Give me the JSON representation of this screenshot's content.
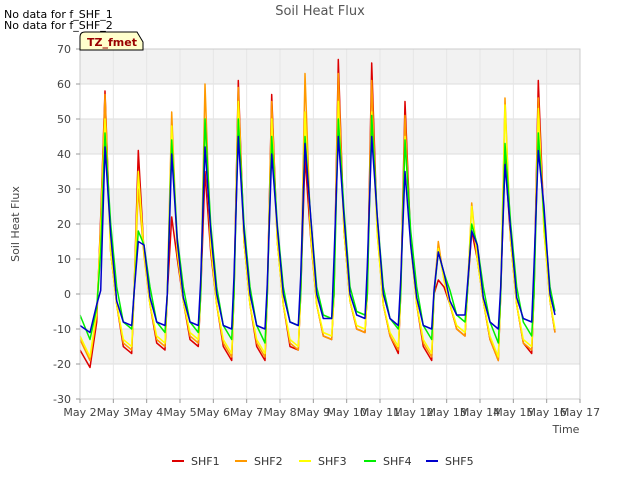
{
  "notes": [
    "No data for f_SHF_1",
    "No data for f_SHF_2"
  ],
  "badge": "TZ_fmet",
  "chart_data": {
    "type": "line",
    "title": "Soil Heat Flux",
    "xlabel": "Time",
    "ylabel": "Soil Heat Flux",
    "xlim": [
      2,
      17
    ],
    "ylim": [
      -30,
      70
    ],
    "xticks": [
      2,
      3,
      4,
      5,
      6,
      7,
      8,
      9,
      10,
      11,
      12,
      13,
      14,
      15,
      16,
      17
    ],
    "xtick_labels": [
      "May 2",
      "May 3",
      "May 4",
      "May 5",
      "May 6",
      "May 7",
      "May 8",
      "May 9",
      "May 10",
      "May 11",
      "May 12",
      "May 13",
      "May 14",
      "May 15",
      "May 16",
      "May 17"
    ],
    "yticks": [
      -30,
      -20,
      -10,
      0,
      10,
      20,
      30,
      40,
      50,
      60,
      70
    ],
    "grid": true,
    "legend_position": "bottom",
    "series": [
      {
        "name": "SHF1",
        "color": "#dd0000",
        "x": [
          2.0,
          2.3,
          2.5,
          2.62,
          2.75,
          2.92,
          3.1,
          3.3,
          3.55,
          3.62,
          3.75,
          3.92,
          4.1,
          4.3,
          4.55,
          4.62,
          4.75,
          4.92,
          5.1,
          5.3,
          5.55,
          5.62,
          5.75,
          5.92,
          6.1,
          6.3,
          6.55,
          6.62,
          6.75,
          6.92,
          7.1,
          7.3,
          7.55,
          7.62,
          7.75,
          7.92,
          8.1,
          8.3,
          8.55,
          8.62,
          8.75,
          8.92,
          9.1,
          9.3,
          9.55,
          9.62,
          9.75,
          9.92,
          10.1,
          10.3,
          10.55,
          10.62,
          10.75,
          10.92,
          11.1,
          11.3,
          11.55,
          11.62,
          11.75,
          11.92,
          12.1,
          12.3,
          12.55,
          12.62,
          12.75,
          12.92,
          13.1,
          13.3,
          13.55,
          13.62,
          13.75,
          13.92,
          14.1,
          14.3,
          14.55,
          14.62,
          14.75,
          14.92,
          15.1,
          15.3,
          15.55,
          15.62,
          15.75,
          15.92,
          16.1,
          16.25
        ],
        "y": [
          -16,
          -21,
          -8,
          22,
          58,
          12,
          -3,
          -15,
          -17,
          0,
          41,
          12,
          -3,
          -14,
          -16,
          0,
          22,
          10,
          -2,
          -13,
          -15,
          0,
          35,
          12,
          -3,
          -15,
          -19,
          0,
          61,
          15,
          -3,
          -15,
          -19,
          0,
          57,
          15,
          -3,
          -15,
          -16,
          0,
          39,
          16,
          -3,
          -12,
          -13,
          0,
          67,
          18,
          -2,
          -10,
          -11,
          0,
          66,
          18,
          -3,
          -12,
          -17,
          0,
          55,
          15,
          -3,
          -15,
          -19,
          0,
          4,
          2,
          -3,
          -10,
          -12,
          0,
          18,
          10,
          -2,
          -13,
          -19,
          0,
          40,
          15,
          -3,
          -14,
          -17,
          0,
          61,
          20,
          -2,
          -11
        ]
      },
      {
        "name": "SHF2",
        "color": "#ff9900",
        "x": [
          2.0,
          2.3,
          2.5,
          2.62,
          2.75,
          2.92,
          3.1,
          3.3,
          3.55,
          3.62,
          3.75,
          3.92,
          4.1,
          4.3,
          4.55,
          4.62,
          4.75,
          4.92,
          5.1,
          5.3,
          5.55,
          5.62,
          5.75,
          5.92,
          6.1,
          6.3,
          6.55,
          6.62,
          6.75,
          6.92,
          7.1,
          7.3,
          7.55,
          7.62,
          7.75,
          7.92,
          8.1,
          8.3,
          8.55,
          8.62,
          8.75,
          8.92,
          9.1,
          9.3,
          9.55,
          9.62,
          9.75,
          9.92,
          10.1,
          10.3,
          10.55,
          10.62,
          10.75,
          10.92,
          11.1,
          11.3,
          11.55,
          11.62,
          11.75,
          11.92,
          12.1,
          12.3,
          12.55,
          12.62,
          12.75,
          12.92,
          13.1,
          13.3,
          13.55,
          13.62,
          13.75,
          13.92,
          14.1,
          14.3,
          14.55,
          14.62,
          14.75,
          14.92,
          15.1,
          15.3,
          15.55,
          15.62,
          15.75,
          15.92,
          16.1,
          16.25
        ],
        "y": [
          -13,
          -19,
          -6,
          20,
          57,
          12,
          -3,
          -14,
          -16,
          0,
          30,
          11,
          -3,
          -13,
          -15,
          0,
          52,
          12,
          -2,
          -12,
          -14,
          0,
          60,
          14,
          -3,
          -14,
          -18,
          0,
          59,
          15,
          -3,
          -14,
          -18,
          0,
          55,
          15,
          -3,
          -14,
          -16,
          0,
          63,
          17,
          -3,
          -12,
          -13,
          0,
          63,
          18,
          -2,
          -10,
          -11,
          0,
          61,
          17,
          -3,
          -12,
          -16,
          0,
          51,
          14,
          -3,
          -14,
          -18,
          0,
          15,
          4,
          -3,
          -10,
          -12,
          0,
          26,
          10,
          -2,
          -13,
          -19,
          0,
          56,
          15,
          -3,
          -14,
          -16,
          0,
          56,
          18,
          -2,
          -11
        ]
      },
      {
        "name": "SHF3",
        "color": "#ffff00",
        "x": [
          2.0,
          2.3,
          2.5,
          2.62,
          2.75,
          2.92,
          3.1,
          3.3,
          3.55,
          3.62,
          3.75,
          3.92,
          4.1,
          4.3,
          4.55,
          4.62,
          4.75,
          4.92,
          5.1,
          5.3,
          5.55,
          5.62,
          5.75,
          5.92,
          6.1,
          6.3,
          6.55,
          6.62,
          6.75,
          6.92,
          7.1,
          7.3,
          7.55,
          7.62,
          7.75,
          7.92,
          8.1,
          8.3,
          8.55,
          8.62,
          8.75,
          8.92,
          9.1,
          9.3,
          9.55,
          9.62,
          9.75,
          9.92,
          10.1,
          10.3,
          10.55,
          10.62,
          10.75,
          10.92,
          11.1,
          11.3,
          11.55,
          11.62,
          11.75,
          11.92,
          12.1,
          12.3,
          12.55,
          12.62,
          12.75,
          12.92,
          13.1,
          13.3,
          13.55,
          13.62,
          13.75,
          13.92,
          14.1,
          14.3,
          14.55,
          14.62,
          14.75,
          14.92,
          15.1,
          15.3,
          15.55,
          15.62,
          15.75,
          15.92,
          16.1,
          16.25
        ],
        "y": [
          -12,
          -18,
          -5,
          18,
          50,
          12,
          -3,
          -13,
          -15,
          0,
          35,
          12,
          -3,
          -12,
          -14,
          0,
          48,
          12,
          -2,
          -11,
          -13,
          0,
          50,
          14,
          -3,
          -13,
          -17,
          0,
          55,
          15,
          -3,
          -13,
          -17,
          0,
          50,
          15,
          -3,
          -13,
          -15,
          0,
          52,
          17,
          -3,
          -11,
          -12,
          0,
          55,
          18,
          -2,
          -9,
          -10,
          0,
          52,
          17,
          -3,
          -11,
          -15,
          0,
          45,
          14,
          -3,
          -13,
          -17,
          0,
          13,
          4,
          -3,
          -9,
          -11,
          0,
          25,
          10,
          -2,
          -12,
          -18,
          0,
          54,
          15,
          -3,
          -13,
          -15,
          0,
          53,
          18,
          -2,
          -10
        ]
      },
      {
        "name": "SHF4",
        "color": "#00ee00",
        "x": [
          2.0,
          2.3,
          2.5,
          2.62,
          2.75,
          2.92,
          3.1,
          3.3,
          3.55,
          3.62,
          3.75,
          3.92,
          4.1,
          4.3,
          4.55,
          4.62,
          4.75,
          4.92,
          5.1,
          5.3,
          5.55,
          5.62,
          5.75,
          5.92,
          6.1,
          6.3,
          6.55,
          6.62,
          6.75,
          6.92,
          7.1,
          7.3,
          7.55,
          7.62,
          7.75,
          7.92,
          8.1,
          8.3,
          8.55,
          8.62,
          8.75,
          8.92,
          9.1,
          9.3,
          9.55,
          9.62,
          9.75,
          9.92,
          10.1,
          10.3,
          10.55,
          10.62,
          10.75,
          10.92,
          11.1,
          11.3,
          11.55,
          11.62,
          11.75,
          11.92,
          12.1,
          12.3,
          12.55,
          12.62,
          12.75,
          12.92,
          13.1,
          13.3,
          13.55,
          13.62,
          13.75,
          13.92,
          14.1,
          14.3,
          14.55,
          14.62,
          14.75,
          14.92,
          15.1,
          15.3,
          15.55,
          15.62,
          15.75,
          15.92,
          16.1,
          16.25
        ],
        "y": [
          -6,
          -13,
          -4,
          12,
          46,
          20,
          2,
          -8,
          -10,
          0,
          18,
          14,
          2,
          -8,
          -11,
          0,
          44,
          16,
          2,
          -8,
          -11,
          0,
          50,
          20,
          2,
          -9,
          -13,
          0,
          50,
          20,
          2,
          -9,
          -14,
          0,
          45,
          20,
          2,
          -8,
          -9,
          0,
          45,
          22,
          2,
          -6,
          -7,
          0,
          50,
          24,
          2,
          -5,
          -6,
          0,
          51,
          22,
          2,
          -7,
          -10,
          0,
          44,
          18,
          2,
          -9,
          -13,
          0,
          12,
          6,
          1,
          -6,
          -8,
          0,
          20,
          14,
          2,
          -8,
          -14,
          0,
          43,
          20,
          2,
          -8,
          -12,
          0,
          46,
          22,
          2,
          -5
        ]
      },
      {
        "name": "SHF5",
        "color": "#0000cc",
        "x": [
          2.0,
          2.3,
          2.5,
          2.62,
          2.75,
          2.92,
          3.1,
          3.3,
          3.55,
          3.62,
          3.75,
          3.92,
          4.1,
          4.3,
          4.55,
          4.62,
          4.75,
          4.92,
          5.1,
          5.3,
          5.55,
          5.62,
          5.75,
          5.92,
          6.1,
          6.3,
          6.55,
          6.62,
          6.75,
          6.92,
          7.1,
          7.3,
          7.55,
          7.62,
          7.75,
          7.92,
          8.1,
          8.3,
          8.55,
          8.62,
          8.75,
          8.92,
          9.1,
          9.3,
          9.55,
          9.62,
          9.75,
          9.92,
          10.1,
          10.3,
          10.55,
          10.62,
          10.75,
          10.92,
          11.1,
          11.3,
          11.55,
          11.62,
          11.75,
          11.92,
          12.1,
          12.3,
          12.55,
          12.62,
          12.75,
          12.92,
          13.1,
          13.3,
          13.55,
          13.62,
          13.75,
          13.92,
          14.1,
          14.3,
          14.55,
          14.62,
          14.75,
          14.92,
          15.1,
          15.3,
          15.55,
          15.62,
          15.75,
          15.92,
          16.1,
          16.25
        ],
        "y": [
          -9,
          -11,
          -3,
          1,
          42,
          17,
          -2,
          -8,
          -9,
          0,
          15,
          14,
          -1,
          -8,
          -9,
          0,
          40,
          15,
          -1,
          -8,
          -9,
          4,
          42,
          18,
          0,
          -9,
          -10,
          5,
          45,
          18,
          0,
          -9,
          -10,
          3,
          40,
          19,
          0,
          -8,
          -9,
          5,
          43,
          22,
          0,
          -7,
          -7,
          10,
          45,
          22,
          0,
          -6,
          -7,
          8,
          45,
          22,
          0,
          -7,
          -9,
          4,
          35,
          14,
          -1,
          -9,
          -10,
          1,
          12,
          6,
          -2,
          -6,
          -6,
          2,
          18,
          14,
          -1,
          -8,
          -10,
          2,
          37,
          18,
          -1,
          -7,
          -8,
          8,
          41,
          25,
          0,
          -6
        ]
      }
    ]
  }
}
